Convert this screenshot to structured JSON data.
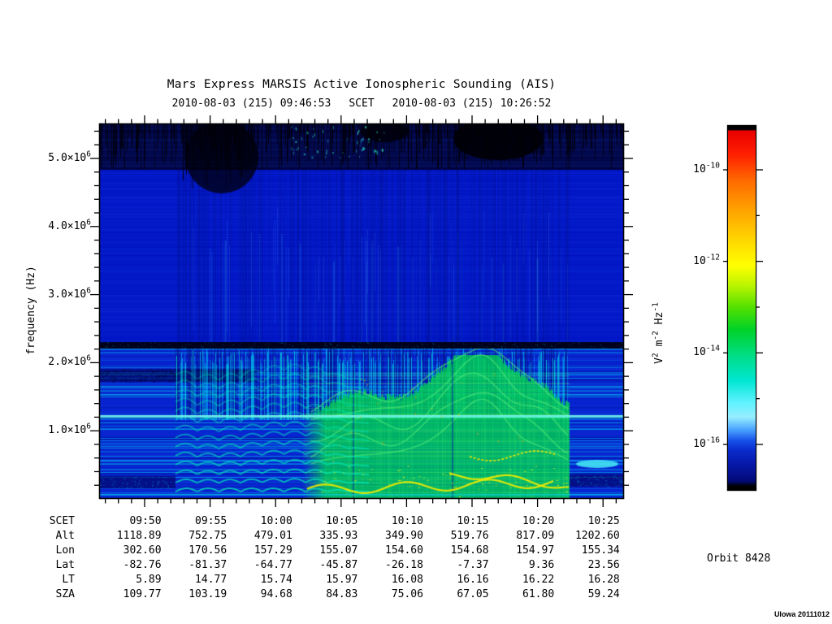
{
  "header": {
    "title": "Mars Express MARSIS Active Ionospheric Sounding (AIS)",
    "scet_start": "2010-08-03 (215) 09:46:53",
    "scet_label": "SCET",
    "scet_end": "2010-08-03 (215) 10:26:52"
  },
  "chart_data": {
    "type": "heatmap",
    "title": "Mars Express MARSIS Active Ionospheric Sounding (AIS)",
    "time_span": {
      "start_scet": "2010-08-03 (215) 09:46:53",
      "end_scet": "2010-08-03 (215) 10:26:52"
    },
    "x_axis": {
      "label": "SCET",
      "major_ticks": [
        "09:50",
        "09:55",
        "10:00",
        "10:05",
        "10:10",
        "10:15",
        "10:20",
        "10:25"
      ],
      "minor_tick_interval_min": 1
    },
    "y_axis": {
      "label": "frequency (Hz)",
      "range_hz": [
        100000,
        5513000
      ],
      "minor_tick_interval_hz": 200000,
      "major_ticks": [
        {
          "text": "5.0×10⁶",
          "base": "5.0×10",
          "exp": "6",
          "value_mhz": 5.0
        },
        {
          "text": "4.0×10⁶",
          "base": "4.0×10",
          "exp": "6",
          "value_mhz": 4.0
        },
        {
          "text": "3.0×10⁶",
          "base": "3.0×10",
          "exp": "6",
          "value_mhz": 3.0
        },
        {
          "text": "2.0×10⁶",
          "base": "2.0×10",
          "exp": "6",
          "value_mhz": 2.0
        },
        {
          "text": "1.0×10⁶",
          "base": "1.0×10",
          "exp": "6",
          "value_mhz": 1.0
        }
      ]
    },
    "colorbar": {
      "unit_text": "V² m⁻² Hz⁻¹",
      "unit_parts": [
        {
          "t": "V",
          "s": "2"
        },
        {
          "t": " m",
          "s": "-2"
        },
        {
          "t": " Hz",
          "s": "-1"
        }
      ],
      "ticks": [
        {
          "text": "10⁻¹⁰",
          "base": "10",
          "exp": "-10",
          "log10": -10
        },
        {
          "text": "10⁻¹²",
          "base": "10",
          "exp": "-12",
          "log10": -12
        },
        {
          "text": "10⁻¹⁴",
          "base": "10",
          "exp": "-14",
          "log10": -14
        },
        {
          "text": "10⁻¹⁶",
          "base": "10",
          "exp": "-16",
          "log10": -16
        }
      ],
      "minor_tick_log10": [
        -11,
        -13,
        -15
      ],
      "range_log10": [
        -9,
        -17
      ],
      "colormap": [
        [
          0.0,
          "#000000"
        ],
        [
          0.01,
          "#000000"
        ],
        [
          0.014,
          "#e80000"
        ],
        [
          0.08,
          "#ff2000"
        ],
        [
          0.15,
          "#ff6a00"
        ],
        [
          0.24,
          "#ffa800"
        ],
        [
          0.33,
          "#ffe000"
        ],
        [
          0.384,
          "#ffff00"
        ],
        [
          0.44,
          "#b8f400"
        ],
        [
          0.5,
          "#50e000"
        ],
        [
          0.56,
          "#00d228"
        ],
        [
          0.636,
          "#00de8c"
        ],
        [
          0.7,
          "#00e6d2"
        ],
        [
          0.76,
          "#60f2ff"
        ],
        [
          0.8,
          "#96eeff"
        ],
        [
          0.835,
          "#48a0ff"
        ],
        [
          0.865,
          "#1650e8"
        ],
        [
          0.89,
          "#0a2ccc"
        ],
        [
          0.93,
          "#0618a8"
        ],
        [
          0.975,
          "#020a78"
        ],
        [
          0.99,
          "#000000"
        ],
        [
          1.0,
          "#000000"
        ]
      ]
    },
    "orbit_label": "Orbit 8428",
    "credit": "UIowa 20111012",
    "features": [
      "dense vertical sounding striations during active AIS window ~09:52-10:22",
      "black interference band at ~2.25 MHz across the entire pass",
      "narrow cyan emission line at ~1.25 MHz across the entire pass",
      "strong green ionospheric echo region below ~1.3 MHz with hummocky upper edge, ~09:57-10:22",
      "bright yellow peak-echo traces near 0.2-0.6 MHz around periapsis (10:00-10:20)",
      "wavy cyan electron-cyclotron echo harmonics 09:52-10:00 below ~1.8 MHz",
      "dark/black noisy band above ~4.8 MHz with black dropout patches",
      "quiet horizontally striped blue/cyan spectrum before 09:52 and after 10:22"
    ],
    "render": {
      "palette": {
        "blue_low": "#0520cc",
        "blue_mid": "#0014c4",
        "blue_top": "#010440",
        "cyan": "#00c8e6",
        "green": "#00d24e",
        "yellow": "#eaf200",
        "cyan_line": "#64f2e6",
        "black_band": "#00000c"
      },
      "top_dark_above_mhz": 4.85,
      "black_band_mhz": [
        2.22,
        2.31
      ],
      "cyan_line_mhz": 1.245,
      "green_top_mhz": 1.27
    }
  },
  "ephemeris": {
    "rows": [
      {
        "label": "SCET",
        "values": [
          "09:50",
          "09:55",
          "10:00",
          "10:05",
          "10:10",
          "10:15",
          "10:20",
          "10:25"
        ]
      },
      {
        "label": "Alt",
        "values": [
          "1118.89",
          "752.75",
          "479.01",
          "335.93",
          "349.90",
          "519.76",
          "817.09",
          "1202.60"
        ]
      },
      {
        "label": "Lon",
        "values": [
          "302.60",
          "170.56",
          "157.29",
          "155.07",
          "154.60",
          "154.68",
          "154.97",
          "155.34"
        ]
      },
      {
        "label": "Lat",
        "values": [
          "-82.76",
          "-81.37",
          "-64.77",
          "-45.87",
          "-26.18",
          "-7.37",
          "9.36",
          "23.56"
        ]
      },
      {
        "label": "LT",
        "values": [
          "5.89",
          "14.77",
          "15.74",
          "15.97",
          "16.08",
          "16.16",
          "16.22",
          "16.28"
        ]
      },
      {
        "label": "SZA",
        "values": [
          "109.77",
          "103.19",
          "94.68",
          "84.83",
          "75.06",
          "67.05",
          "61.80",
          "59.24"
        ]
      }
    ]
  }
}
